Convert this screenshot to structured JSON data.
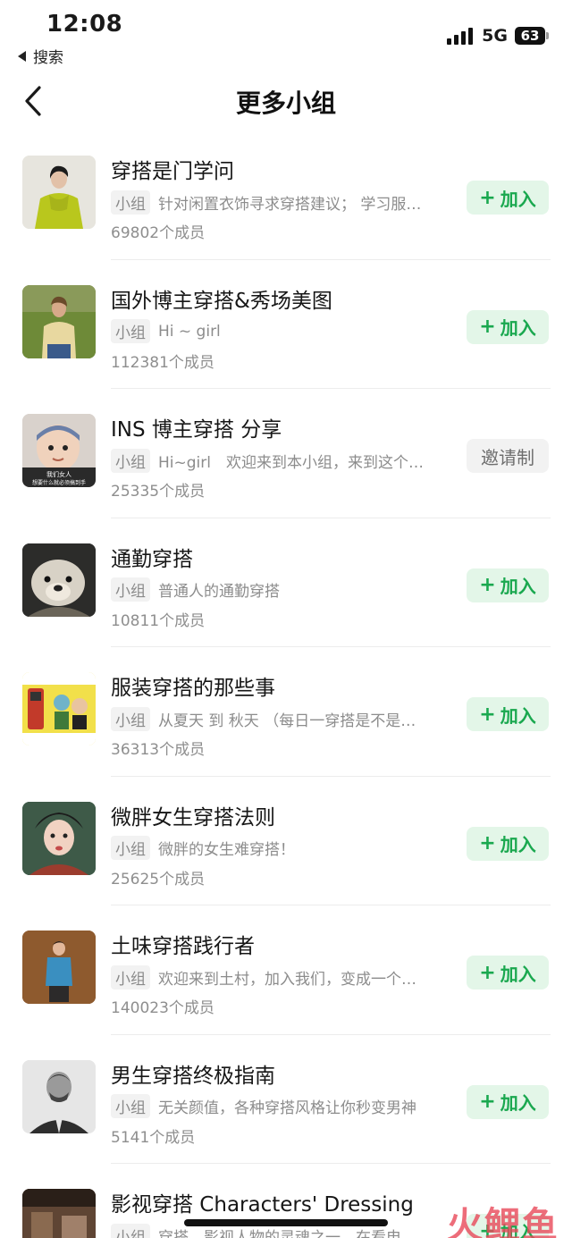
{
  "status_bar": {
    "time": "12:08",
    "back_app": "搜索",
    "network": "5G",
    "battery": "63"
  },
  "nav": {
    "title": "更多小组"
  },
  "tag_label": "小组",
  "groups": [
    {
      "name": "穿搭是门学问",
      "desc": "针对闲置衣饰寻求穿搭建议； 学习服…",
      "members": "69802个成员",
      "button": "加入",
      "type": "join"
    },
    {
      "name": "国外博主穿搭&秀场美图",
      "desc": "Hi ~ girl",
      "members": "112381个成员",
      "button": "加入",
      "type": "join"
    },
    {
      "name": "INS 博主穿搭 分享",
      "desc": "Hi~girl　欢迎来到本小组，来到这个…",
      "members": "25335个成员",
      "button": "邀请制",
      "type": "invite",
      "avatar_caption": "我们女人 想要什么就必须搞到手"
    },
    {
      "name": "通勤穿搭",
      "desc": "普通人的通勤穿搭",
      "members": "10811个成员",
      "button": "加入",
      "type": "join"
    },
    {
      "name": "服装穿搭的那些事",
      "desc": "从夏天 到 秋天 （每日一穿搭是不是…",
      "members": "36313个成员",
      "button": "加入",
      "type": "join"
    },
    {
      "name": "微胖女生穿搭法则",
      "desc": "微胖的女生难穿搭！",
      "members": "25625个成员",
      "button": "加入",
      "type": "join"
    },
    {
      "name": "土味穿搭践行者",
      "desc": "欢迎来到土村，加入我们，变成一个…",
      "members": "140023个成员",
      "button": "加入",
      "type": "join"
    },
    {
      "name": "男生穿搭终极指南",
      "desc": "无关颜值，各种穿搭风格让你秒变男神",
      "members": "5141个成员",
      "button": "加入",
      "type": "join"
    },
    {
      "name": "影视穿搭 Characters' Dressing",
      "desc": "穿搭，影视人物的灵魂之一，在看电…",
      "members": "",
      "button": "加入",
      "type": "join"
    }
  ],
  "watermark": "火鲤鱼",
  "colors": {
    "accent_green": "#1aa84f",
    "join_bg": "#e3f6e8"
  },
  "icons": {
    "back": "chevron-left-icon",
    "plus": "plus-icon"
  }
}
